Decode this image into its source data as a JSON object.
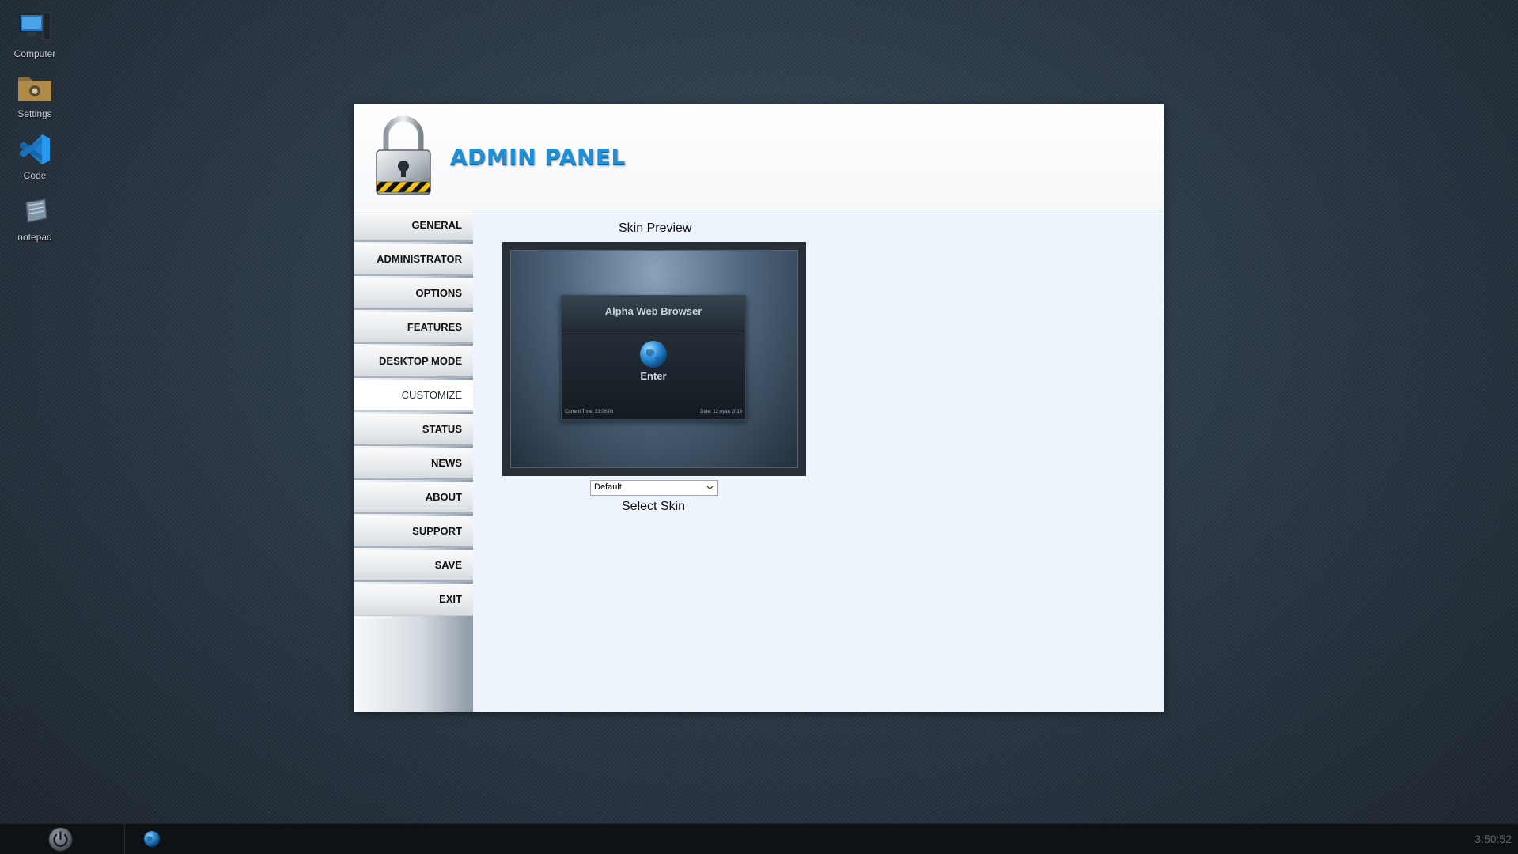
{
  "desktop": {
    "icons": [
      {
        "label": "Computer",
        "icon": "computer-icon"
      },
      {
        "label": "Settings",
        "icon": "settings-folder-icon"
      },
      {
        "label": "Code",
        "icon": "code-editor-icon"
      },
      {
        "label": "notepad",
        "icon": "notepad-icon"
      }
    ]
  },
  "admin": {
    "title": "ADMIN PANEL",
    "logo_icon": "padlock-icon",
    "nav": [
      {
        "label": "GENERAL",
        "active": false
      },
      {
        "label": "ADMINISTRATOR",
        "active": false
      },
      {
        "label": "OPTIONS",
        "active": false
      },
      {
        "label": "FEATURES",
        "active": false
      },
      {
        "label": "DESKTOP MODE",
        "active": false
      },
      {
        "label": "CUSTOMIZE",
        "active": true
      },
      {
        "label": "STATUS",
        "active": false
      },
      {
        "label": "NEWS",
        "active": false
      },
      {
        "label": "ABOUT",
        "active": false
      },
      {
        "label": "SUPPORT",
        "active": false
      },
      {
        "label": "SAVE",
        "active": false
      },
      {
        "label": "EXIT",
        "active": false
      }
    ],
    "content": {
      "preview_title": "Skin Preview",
      "preview": {
        "card_title": "Alpha Web Browser",
        "enter_label": "Enter",
        "time_text": "Current Time: 23:06:06",
        "date_text": "Date: 12 Ayan 2013"
      },
      "skin_select_value": "Default",
      "select_label": "Select Skin"
    }
  },
  "taskbar": {
    "start_icon": "power-icon",
    "app_icon": "globe-icon",
    "clock": "3:50:52"
  },
  "colors": {
    "title_blue": "#1f8fd6",
    "content_bg": "#edf4fb",
    "taskbar_bg": "#0f1215"
  }
}
